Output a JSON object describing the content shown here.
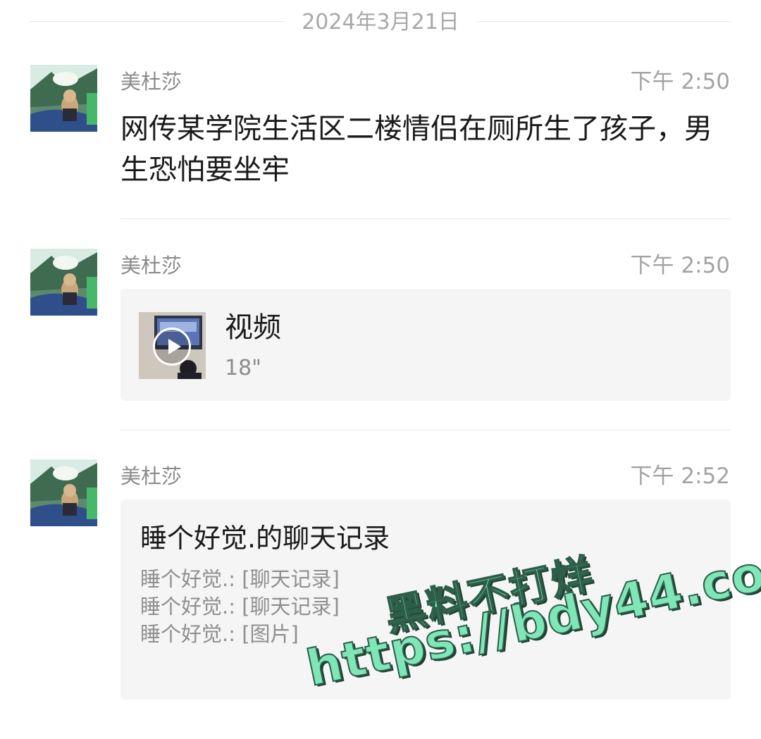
{
  "date_separator": "2024年3月21日",
  "messages": [
    {
      "sender": "美杜莎",
      "time": "下午 2:50",
      "text": "网传某学院生活区二楼情侣在厕所生了孩子，男生恐怕要坐牢"
    },
    {
      "sender": "美杜莎",
      "time": "下午 2:50",
      "video": {
        "title": "视频",
        "duration": "18\""
      }
    },
    {
      "sender": "美杜莎",
      "time": "下午 2:52",
      "chat_record": {
        "title": "睡个好觉.的聊天记录",
        "lines": [
          "睡个好觉.: [聊天记录]",
          "睡个好觉.: [聊天记录]",
          "睡个好觉.: [图片]"
        ]
      }
    }
  ],
  "watermark": {
    "line1": "黑料不打烊",
    "line2": "https://bdy44.co"
  },
  "colors": {
    "watermark_fill": "#7fe6b8",
    "card_bg": "#f5f5f5"
  }
}
